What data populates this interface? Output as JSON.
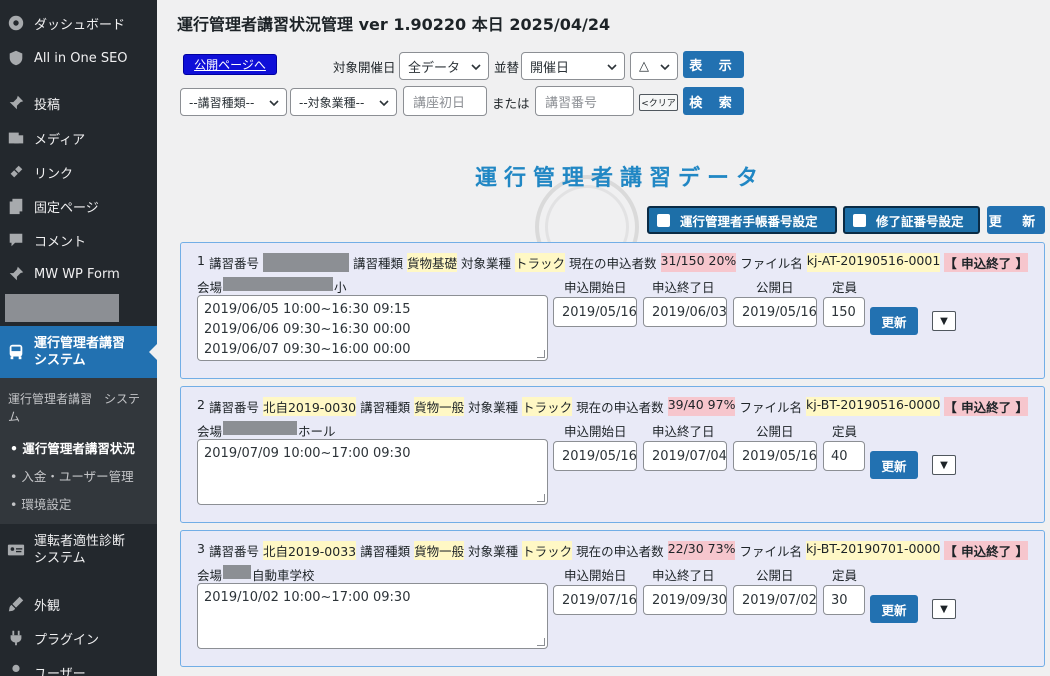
{
  "sidebar": {
    "items": [
      {
        "label": "ダッシュボード",
        "icon": "dashboard-icon"
      },
      {
        "label": "All in One SEO",
        "icon": "shield-icon"
      },
      {
        "label": "投稿",
        "icon": "pin-icon"
      },
      {
        "label": "メディア",
        "icon": "media-icon"
      },
      {
        "label": "リンク",
        "icon": "link-icon"
      },
      {
        "label": "固定ページ",
        "icon": "page-icon"
      },
      {
        "label": "コメント",
        "icon": "comment-icon"
      },
      {
        "label": "MW WP Form",
        "icon": "pin-icon"
      },
      {
        "label": "運行管理者講習\nシステム",
        "icon": "bus-icon"
      },
      {
        "label": "運転者適性診断\nシステム",
        "icon": "id-card-icon"
      },
      {
        "label": "外観",
        "icon": "brush-icon"
      },
      {
        "label": "プラグイン",
        "icon": "plugin-icon"
      },
      {
        "label": "ユーザー",
        "icon": "user-icon"
      }
    ],
    "submenu": {
      "title": "運行管理者講習　システム",
      "items": [
        "運行管理者講習状況",
        "入金・ユーザー管理",
        "環境設定"
      ]
    }
  },
  "page": {
    "title": "運行管理者講習状況管理 ver 1.90220 本日 2025/04/24",
    "heading": "運行管理者講習データ"
  },
  "toolbar": {
    "public_button": "公開ページへ",
    "held_label": "対象開催日",
    "held_value": "全データ",
    "sort_label": "並替",
    "sort_value": "開催日",
    "order_value": "△",
    "show_button": "表 示",
    "type_select": "--講習種類--",
    "industry_select": "--対象業種--",
    "first_day_placeholder": "講座初日",
    "or_label": "または",
    "number_placeholder": "講習番号",
    "clear_button": "<クリア",
    "search_button": "検 索"
  },
  "actions": {
    "handbook_button": "運行管理者手帳番号設定",
    "certificate_button": "修了証番号設定",
    "update_button": "更 新"
  },
  "labels": {
    "course_number": "講習番号",
    "course_type": "講習種類",
    "industry": "対象業種",
    "applicants": "現在の申込者数",
    "file_name": "ファイル名",
    "venue": "会場",
    "apply_start": "申込開始日",
    "apply_end": "申込終了日",
    "publish_date": "公開日",
    "capacity": "定員",
    "update": "更新",
    "dropdown": "▼"
  },
  "courses": [
    {
      "index": "1",
      "number": "",
      "type": "貨物基礎",
      "industry": "トラック",
      "applicants": "31/150 20%",
      "file": "kj-AT-20190516-0001",
      "status": "【 申込終了 】",
      "venue_suffix": "小",
      "schedule": "2019/06/05 10:00~16:30 09:15\n2019/06/06 09:30~16:30 00:00\n2019/06/07 09:30~16:00 00:00",
      "apply_start": "2019/05/16",
      "apply_end": "2019/06/03",
      "publish": "2019/05/16",
      "capacity": "150"
    },
    {
      "index": "2",
      "number": "北自2019-0030",
      "type": "貨物一般",
      "industry": "トラック",
      "applicants": "39/40 97%",
      "file": "kj-BT-20190516-0000",
      "status": "【 申込終了 】",
      "venue_suffix": "ホール",
      "schedule": "2019/07/09 10:00~17:00 09:30",
      "apply_start": "2019/05/16",
      "apply_end": "2019/07/04",
      "publish": "2019/05/16",
      "capacity": "40"
    },
    {
      "index": "3",
      "number": "北自2019-0033",
      "type": "貨物一般",
      "industry": "トラック",
      "applicants": "22/30 73%",
      "file": "kj-BT-20190701-0000",
      "status": "【 申込終了 】",
      "venue_suffix": "自動車学校",
      "schedule": "2019/10/02 10:00~17:00 09:30",
      "apply_start": "2019/07/16",
      "apply_end": "2019/09/30",
      "publish": "2019/07/02",
      "capacity": "30"
    }
  ]
}
